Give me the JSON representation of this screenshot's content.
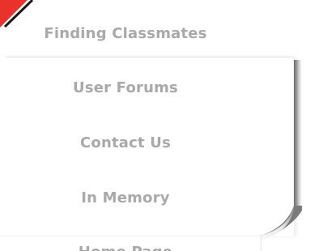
{
  "menu": {
    "items": [
      {
        "label": "Finding Classmates"
      },
      {
        "label": "User Forums"
      },
      {
        "label": "Contact Us"
      },
      {
        "label": "In Memory"
      },
      {
        "label": "Home Page"
      }
    ]
  },
  "colors": {
    "accent": "#e8322a",
    "menu_text": "#a9a9a9",
    "background": "#ffffff"
  },
  "icons": {
    "corner": "red-corner-flag-icon",
    "curl": "page-curl-icon"
  }
}
